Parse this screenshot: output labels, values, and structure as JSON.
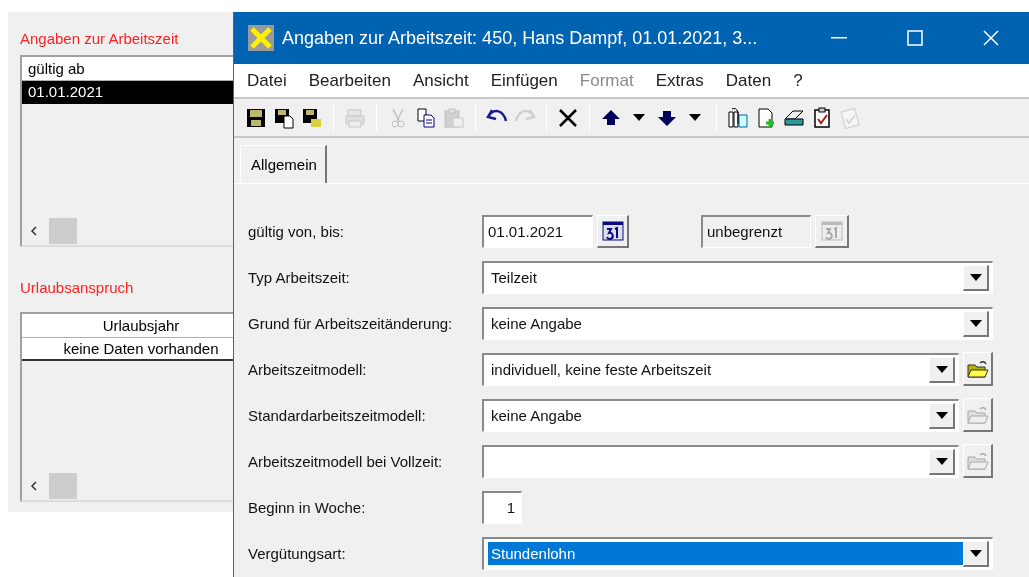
{
  "background_window": {
    "title": "Angaben zur Arbeitszeit",
    "validity_list": {
      "column": "gültig ab",
      "rows": [
        {
          "text": "01.01.2021",
          "selected": true
        }
      ]
    },
    "vacation": {
      "title": "Urlaubsanspruch",
      "column": "Urlaubsjahr",
      "rows": [
        "keine Daten vorhanden"
      ]
    }
  },
  "window": {
    "title": "Angaben zur Arbeitszeit: 450, Hans Dampf, 01.01.2021, 3..."
  },
  "menu": [
    {
      "label": "Datei",
      "disabled": false
    },
    {
      "label": "Bearbeiten",
      "disabled": false
    },
    {
      "label": "Ansicht",
      "disabled": false
    },
    {
      "label": "Einfügen",
      "disabled": false
    },
    {
      "label": "Format",
      "disabled": true
    },
    {
      "label": "Extras",
      "disabled": false
    },
    {
      "label": "Daten",
      "disabled": false
    },
    {
      "label": "?",
      "disabled": false
    }
  ],
  "toolbar": [
    [
      {
        "disabled": false
      },
      {
        "disabled": false
      },
      {
        "disabled": false
      }
    ],
    [
      {
        "disabled": true
      }
    ],
    [
      {
        "disabled": true
      },
      {
        "disabled": false
      },
      {
        "disabled": true
      }
    ],
    [
      {
        "disabled": false
      },
      {
        "disabled": true
      }
    ],
    [
      {
        "disabled": false
      }
    ],
    [
      {
        "disabled": false
      },
      {
        "disabled": false
      }
    ],
    [
      {
        "disabled": false
      },
      {
        "disabled": false
      },
      {
        "disabled": false
      },
      {
        "disabled": false
      },
      {
        "disabled": true
      }
    ]
  ],
  "tabs": [
    {
      "label": "Allgemein",
      "selected": true
    }
  ],
  "fields": [
    {
      "kind": "date_range",
      "label": "gültig von, bis:",
      "from": {
        "value": "01.01.2021",
        "disabled": false
      },
      "to": {
        "value": "unbegrenzt",
        "disabled": true
      }
    },
    {
      "kind": "combo",
      "label": "Typ Arbeitszeit:",
      "value": "Teilzeit",
      "selected": false
    },
    {
      "kind": "combo",
      "label": "Grund für Arbeitszeitänderung:",
      "value": "keine Angabe",
      "selected": false
    },
    {
      "kind": "combo",
      "label": "Arbeitszeitmodell:",
      "value": "individuell, keine feste Arbeitszeit",
      "selected": false,
      "browse": {
        "disabled": false
      }
    },
    {
      "kind": "combo",
      "label": "Standardarbeitszeitmodell:",
      "value": "keine Angabe",
      "selected": false,
      "browse": {
        "disabled": true
      }
    },
    {
      "kind": "combo",
      "label": "Arbeitszeitmodell bei Vollzeit:",
      "selected": false,
      "browse": {
        "disabled": true
      }
    },
    {
      "kind": "number",
      "label": "Beginn in Woche:",
      "value": "1"
    },
    {
      "kind": "combo",
      "label": "Vergütungsart:",
      "value": "Stundenlohn",
      "selected": true
    }
  ]
}
